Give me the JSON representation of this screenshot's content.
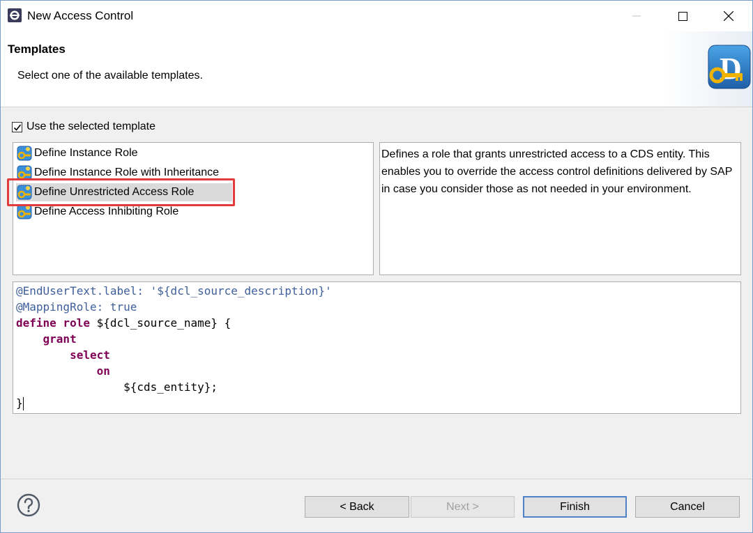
{
  "window": {
    "title": "New Access Control",
    "controls": [
      "minimize-icon",
      "maximize-icon",
      "close-icon"
    ]
  },
  "header": {
    "title": "Templates",
    "description": "Select one of the available templates."
  },
  "use_template": {
    "label": "Use the selected template",
    "checked": true
  },
  "templates": {
    "selected_index": 2,
    "items": [
      {
        "label": "Define Instance Role",
        "icon": "template-key-icon"
      },
      {
        "label": "Define Instance Role with Inheritance",
        "icon": "template-key-icon"
      },
      {
        "label": "Define Unrestricted Access Role",
        "icon": "template-key-icon"
      },
      {
        "label": "Define Access Inhibiting Role",
        "icon": "template-key-icon"
      }
    ]
  },
  "template_description": "Defines a role that grants unrestricted access to a CDS entity. This enables you to override the access control definitions delivered by SAP in case you consider those as not needed in your environment.",
  "code_preview": {
    "line1": "@EndUserText.label: '${dcl_source_description}'",
    "line2": "@MappingRole: true",
    "line3_kw": "define role ",
    "line3_rest": "${dcl_source_name} {",
    "line4": "grant",
    "line5": "select",
    "line6": "on",
    "line7": "${cds_entity};",
    "line8": "}"
  },
  "buttons": {
    "back": "< Back",
    "next": "Next >",
    "finish": "Finish",
    "cancel": "Cancel"
  },
  "colors": {
    "annotation": "#3e5f9b",
    "keyword": "#7f0055",
    "highlight": "#e23b3b"
  }
}
